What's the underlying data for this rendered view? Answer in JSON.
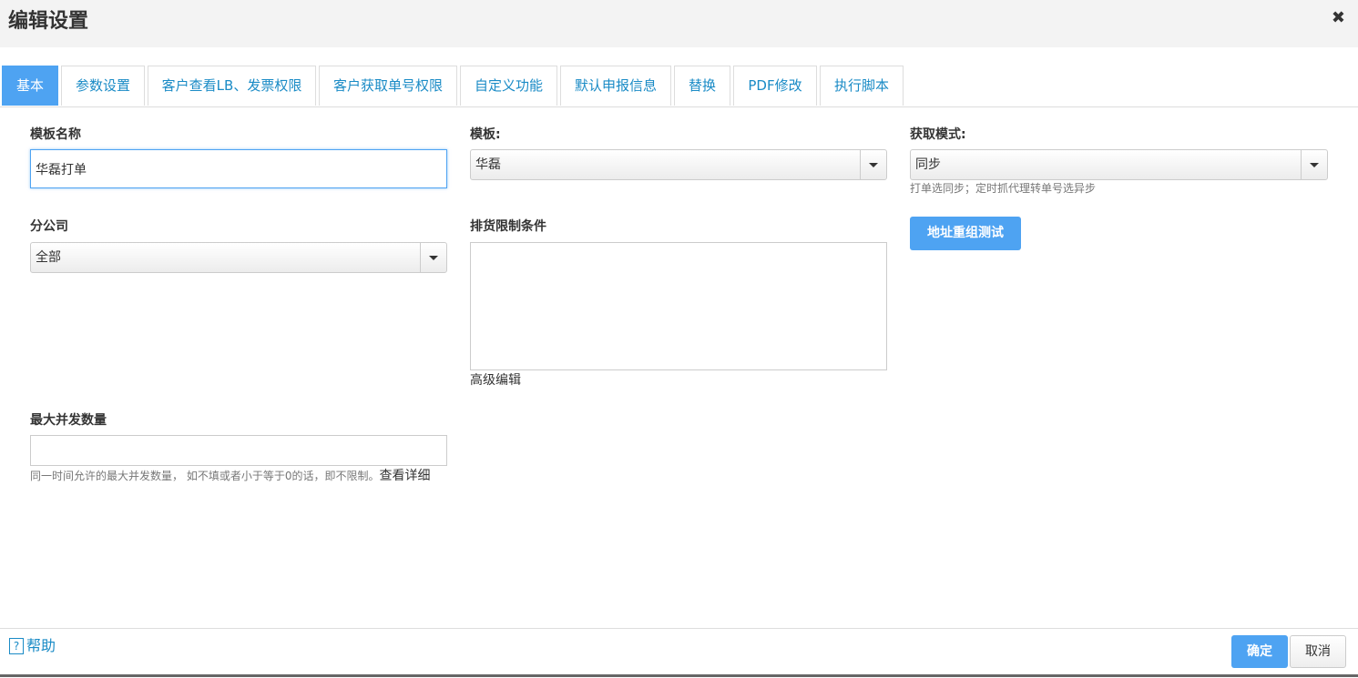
{
  "dialog": {
    "title": "编辑设置",
    "close_symbol": "✖"
  },
  "tabs": [
    {
      "label": "基本",
      "active": true
    },
    {
      "label": "参数设置"
    },
    {
      "label": "客户查看LB、发票权限"
    },
    {
      "label": "客户获取单号权限"
    },
    {
      "label": "自定义功能"
    },
    {
      "label": "默认申报信息"
    },
    {
      "label": "替换"
    },
    {
      "label": "PDF修改"
    },
    {
      "label": "执行脚本"
    }
  ],
  "form": {
    "template_name": {
      "label": "模板名称",
      "value": "华磊打单"
    },
    "template": {
      "label": "模板:",
      "value": "华磊"
    },
    "fetch_mode": {
      "label": "获取模式:",
      "value": "同步",
      "hint": "打单选同步；定时抓代理转单号选异步"
    },
    "branch": {
      "label": "分公司",
      "value": "全部"
    },
    "shipping_restrictions": {
      "label": "排货限制条件",
      "value": "",
      "advanced_edit": "高级编辑"
    },
    "address_test_button": "地址重组测试",
    "max_concurrency": {
      "label": "最大并发数量",
      "value": "",
      "hint": "同一时间允许的最大并发数量， 如不填或者小于等于0的话，即不限制。",
      "details_link": "查看详细"
    }
  },
  "footer": {
    "help": "帮助",
    "confirm": "确定",
    "cancel": "取消"
  },
  "colors": {
    "accent": "#4ea3f2",
    "link": "#1a8bc6"
  }
}
